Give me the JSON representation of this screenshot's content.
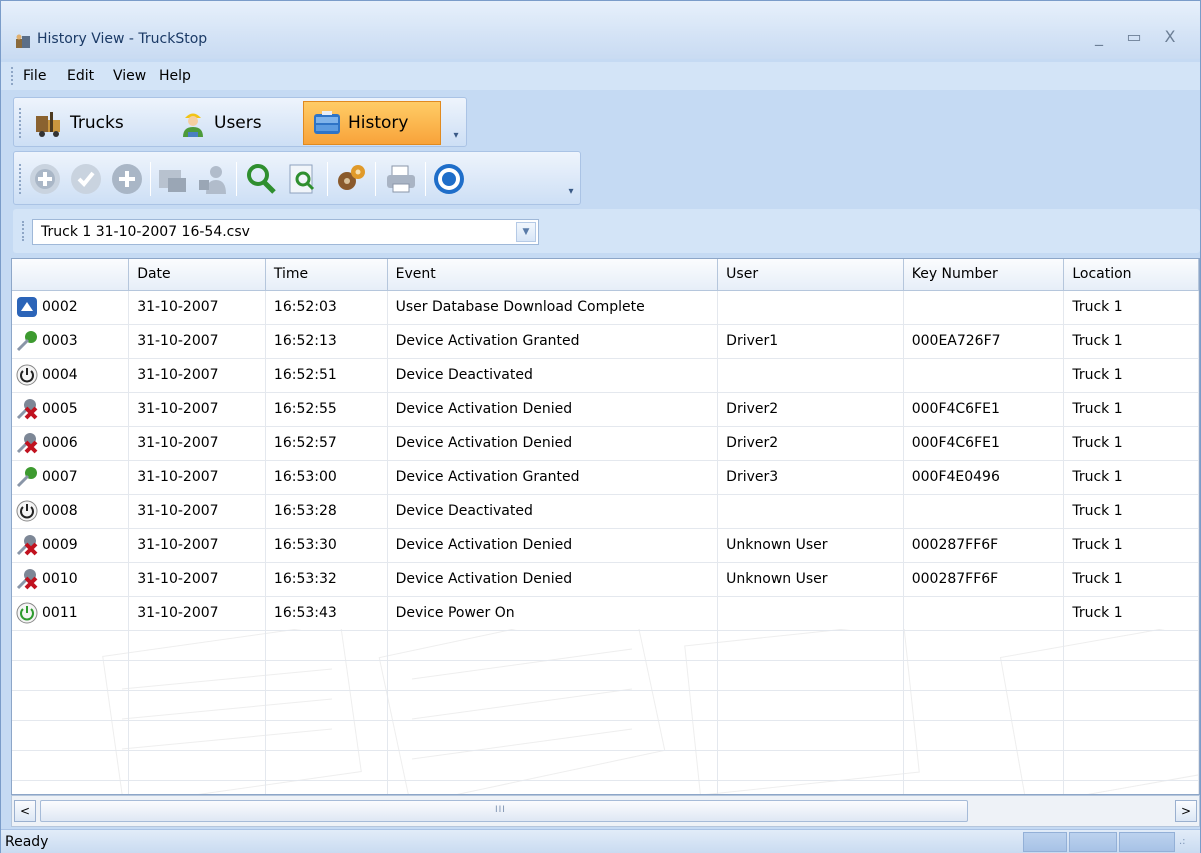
{
  "window": {
    "title": "History View - TruckStop",
    "controls": {
      "minimize": "_",
      "maximize": "▭",
      "close": "X"
    }
  },
  "menu": {
    "items": [
      "File",
      "Edit",
      "View",
      "Help"
    ]
  },
  "nav_toolbar": {
    "buttons": [
      {
        "label": "Trucks",
        "icon": "trucks-icon",
        "active": false
      },
      {
        "label": "Users",
        "icon": "users-icon",
        "active": false
      },
      {
        "label": "History",
        "icon": "history-icon",
        "active": true
      }
    ],
    "overflow": "▾"
  },
  "action_toolbar": {
    "icons": [
      "add-icon",
      "check-icon",
      "plus-circle-icon",
      "truck-export-icon",
      "user-export-icon",
      "search-icon",
      "search-document-icon",
      "settings-gears-icon",
      "print-icon",
      "help-icon"
    ],
    "overflow": "▾"
  },
  "file_selector": {
    "value": "Truck 1 31-10-2007 16-54.csv",
    "arrow": "▼"
  },
  "grid": {
    "columns": [
      "",
      "Date",
      "Time",
      "Event",
      "User",
      "Key Number",
      "Location"
    ],
    "rows": [
      {
        "icon": "download-icon",
        "id": "0002",
        "date": "31-10-2007",
        "time": "16:52:03",
        "event": "User Database Download Complete",
        "user": "",
        "key": "",
        "location": "Truck 1"
      },
      {
        "icon": "activation-granted-icon",
        "id": "0003",
        "date": "31-10-2007",
        "time": "16:52:13",
        "event": "Device Activation Granted",
        "user": "Driver1",
        "key": "000EA726F7",
        "location": "Truck 1"
      },
      {
        "icon": "power-off-icon",
        "id": "0004",
        "date": "31-10-2007",
        "time": "16:52:51",
        "event": "Device Deactivated",
        "user": "",
        "key": "",
        "location": "Truck 1"
      },
      {
        "icon": "activation-denied-icon",
        "id": "0005",
        "date": "31-10-2007",
        "time": "16:52:55",
        "event": "Device Activation Denied",
        "user": "Driver2",
        "key": "000F4C6FE1",
        "location": "Truck 1"
      },
      {
        "icon": "activation-denied-icon",
        "id": "0006",
        "date": "31-10-2007",
        "time": "16:52:57",
        "event": "Device Activation Denied",
        "user": "Driver2",
        "key": "000F4C6FE1",
        "location": "Truck 1"
      },
      {
        "icon": "activation-granted-icon",
        "id": "0007",
        "date": "31-10-2007",
        "time": "16:53:00",
        "event": "Device Activation Granted",
        "user": "Driver3",
        "key": "000F4E0496",
        "location": "Truck 1"
      },
      {
        "icon": "power-off-icon",
        "id": "0008",
        "date": "31-10-2007",
        "time": "16:53:28",
        "event": "Device Deactivated",
        "user": "",
        "key": "",
        "location": "Truck 1"
      },
      {
        "icon": "activation-denied-icon",
        "id": "0009",
        "date": "31-10-2007",
        "time": "16:53:30",
        "event": "Device Activation Denied",
        "user": "Unknown User",
        "key": "000287FF6F",
        "location": "Truck 1"
      },
      {
        "icon": "activation-denied-icon",
        "id": "0010",
        "date": "31-10-2007",
        "time": "16:53:32",
        "event": "Device Activation Denied",
        "user": "Unknown User",
        "key": "000287FF6F",
        "location": "Truck 1"
      },
      {
        "icon": "power-on-icon",
        "id": "0011",
        "date": "31-10-2007",
        "time": "16:53:43",
        "event": "Device Power On",
        "user": "",
        "key": "",
        "location": "Truck 1"
      }
    ]
  },
  "scrollbar": {
    "left": "<",
    "right": ">",
    "grip": "III"
  },
  "status": {
    "text": "Ready",
    "resize_grip": ".:"
  },
  "colors": {
    "frame": "#c5daf3",
    "active_tab": "#f8a33a",
    "granted": "#3d9a2f",
    "denied": "#c1121f",
    "power_on": "#2e9a2e"
  }
}
